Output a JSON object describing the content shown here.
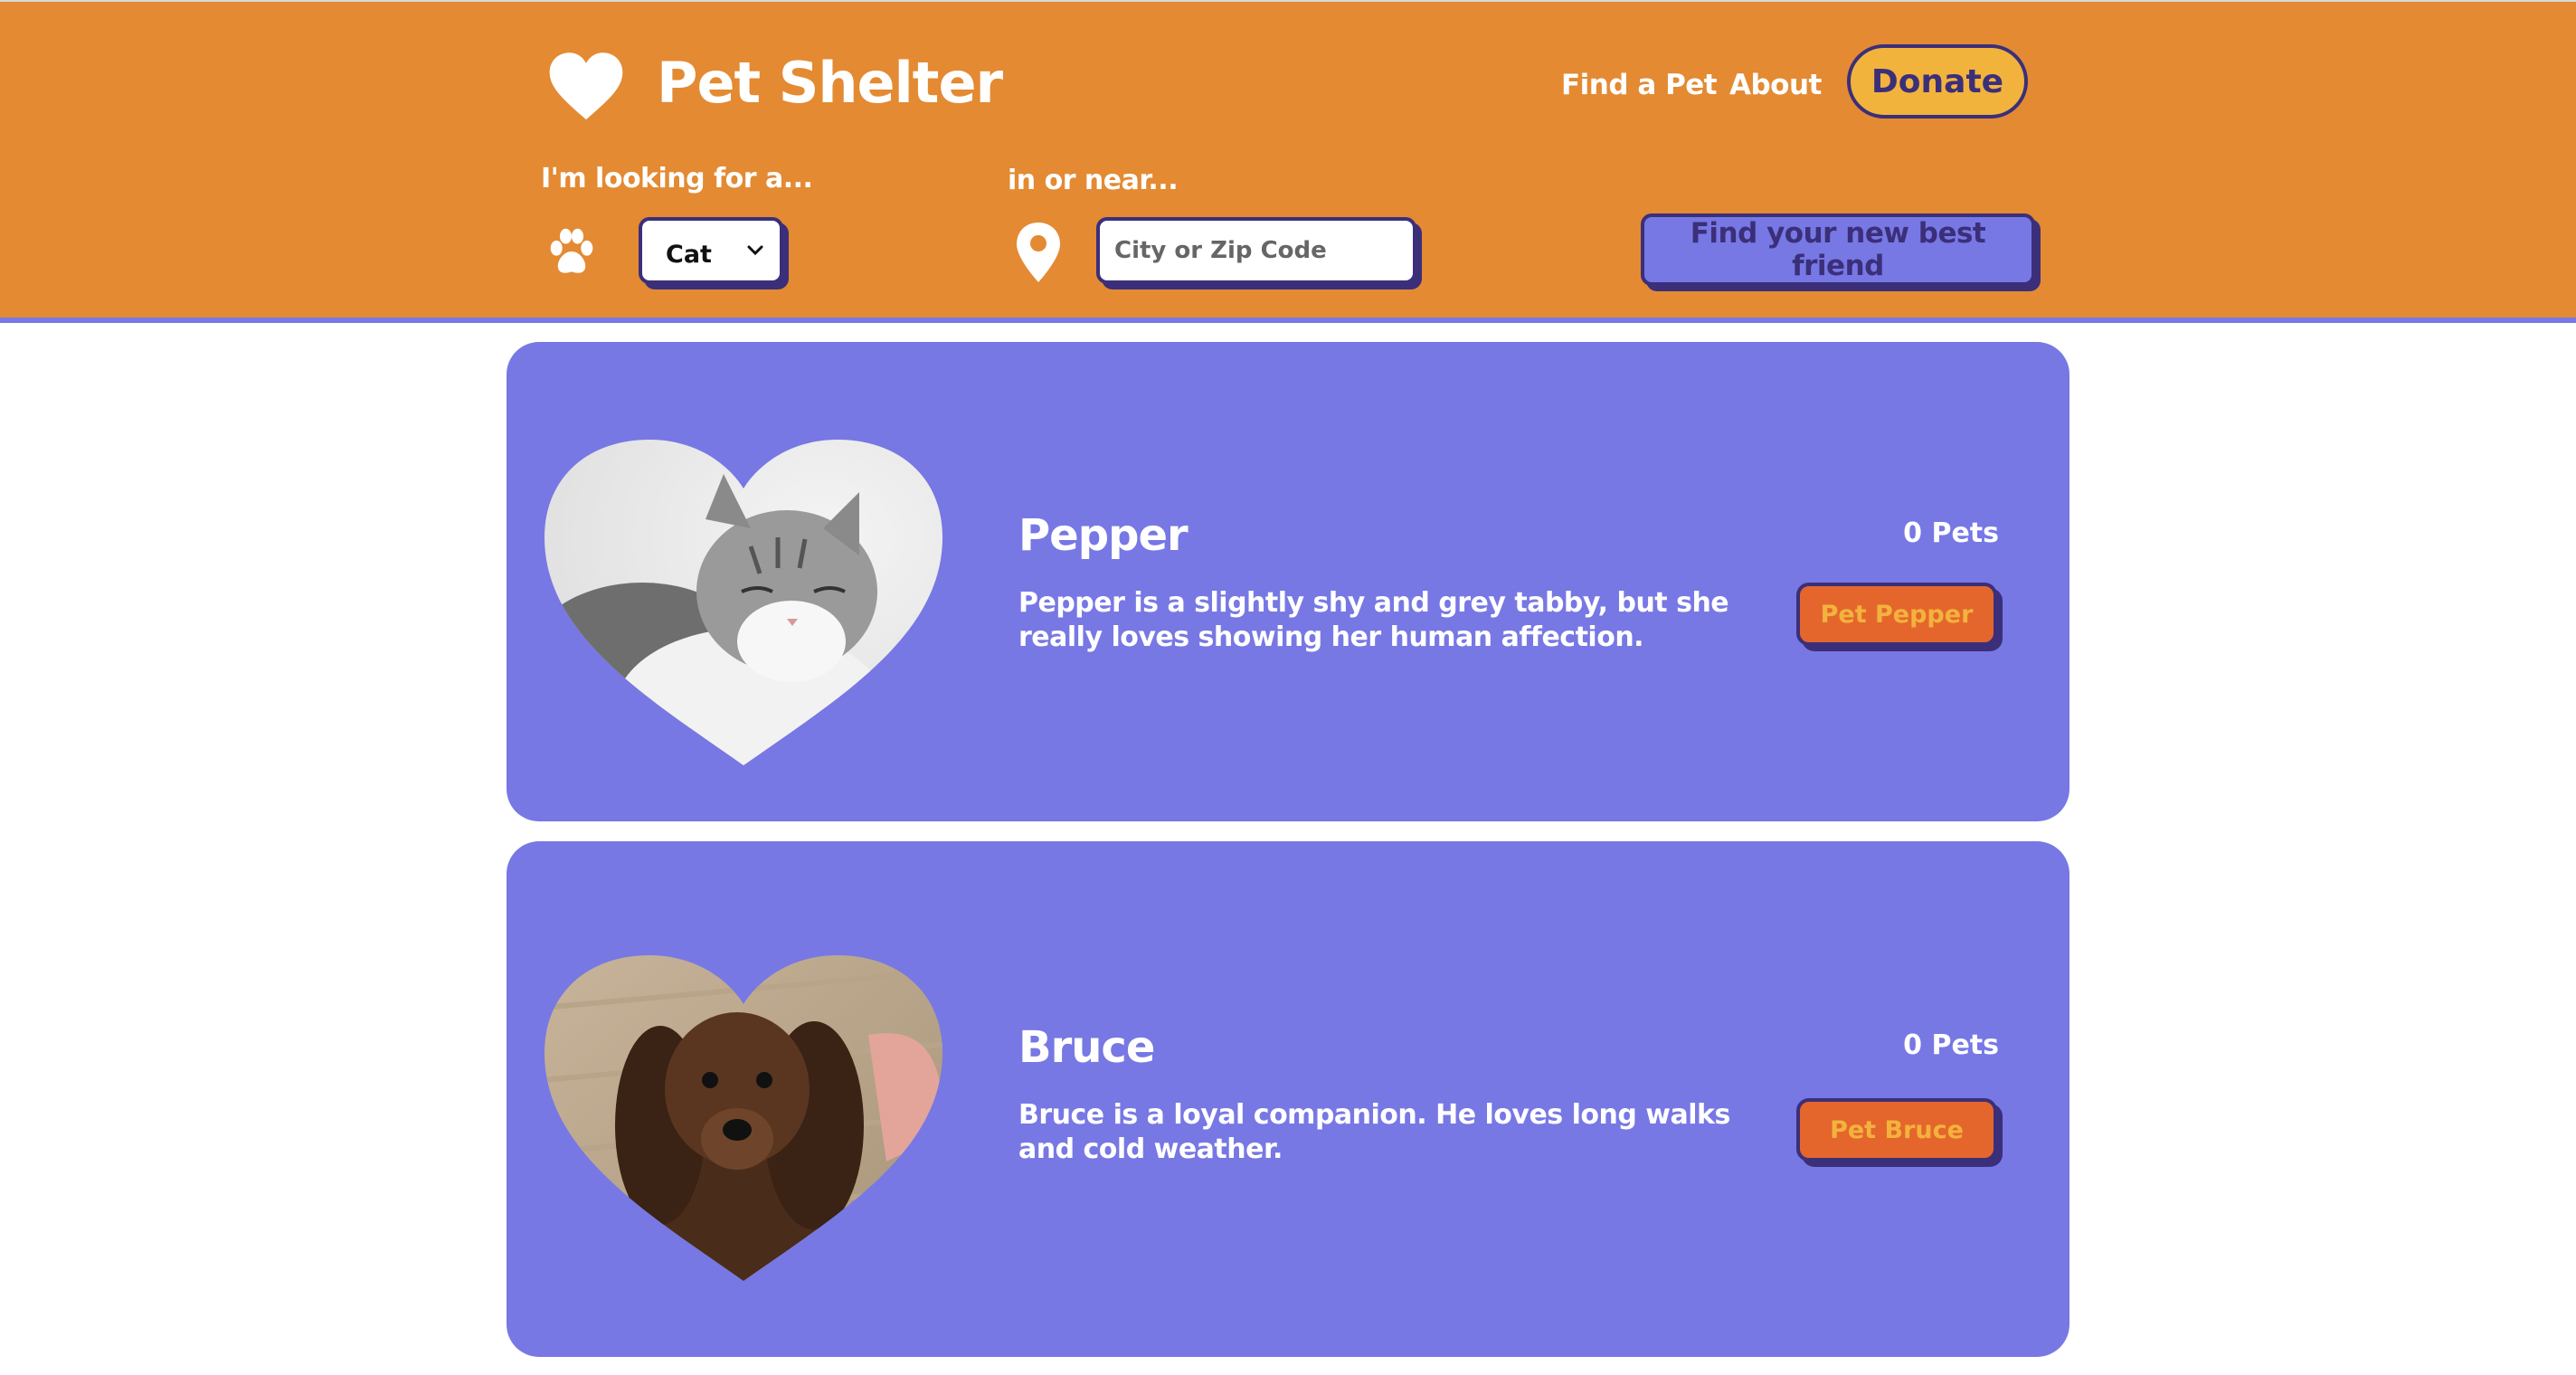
{
  "header": {
    "brand": "Pet Shelter",
    "nav": {
      "find_a_pet": "Find a Pet",
      "about": "About"
    },
    "donate_label": "Donate",
    "colors": {
      "header_bg": "#e38a33",
      "accent_purple": "#7778e4",
      "dark_purple": "#3b2f7a",
      "donate_yellow": "#f2b33d"
    }
  },
  "search": {
    "looking_for_label": "I'm looking for a...",
    "species_selected": "Cat",
    "near_label": "in or near...",
    "location_placeholder": "City or Zip Code",
    "location_value": "",
    "submit_label": "Find your new best friend"
  },
  "pets": [
    {
      "name": "Pepper",
      "count": "0 Pets",
      "description": "Pepper is a slightly shy and grey tabby, but she really loves showing her human affection.",
      "button": "Pet Pepper"
    },
    {
      "name": "Bruce",
      "count": "0 Pets",
      "description": "Bruce is a loyal companion. He loves long walks and cold weather.",
      "button": "Pet Bruce"
    }
  ]
}
